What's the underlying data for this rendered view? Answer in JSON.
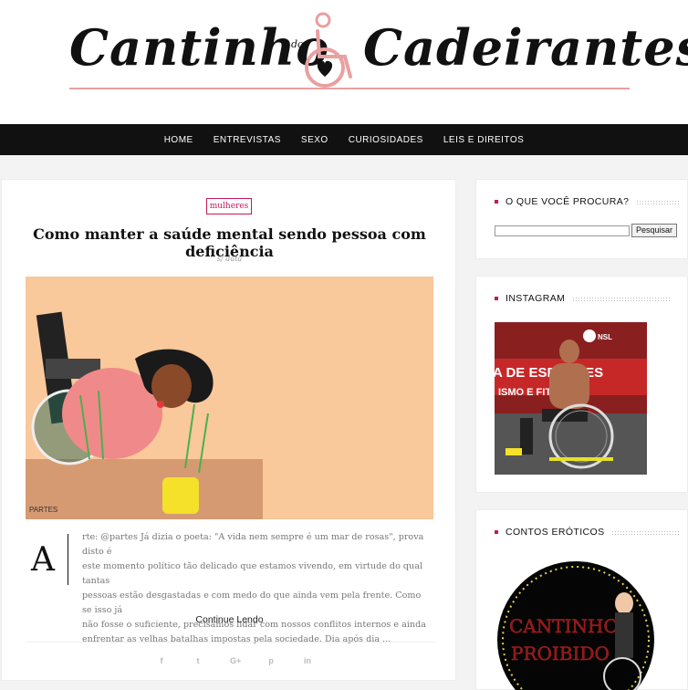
{
  "logo": {
    "left_text": "Cantinho",
    "small_text": "dos",
    "right_text": "Cadeirantes"
  },
  "nav": {
    "items": [
      "HOME",
      "ENTREVISTAS",
      "SEXO",
      "CURIOSIDADES",
      "LEIS E DIREITOS"
    ]
  },
  "post": {
    "category": "mulheres",
    "title": "Como manter a saúde mental sendo pessoa com deficiência",
    "date": "s/ data",
    "image_caption": "PARTES",
    "dropcap": "A",
    "excerpt_lines": [
      "rte: @partes  Já dizia o poeta: \"A vida nem sempre é um mar de rosas\", prova disto é",
      "este momento político tão delicado que estamos vivendo, em virtude do qual tantas",
      "pessoas estão desgastadas e com medo do que ainda vem pela frente. Como se isso já",
      "não fosse o suficiente, precisamos lidar com nossos conflitos internos e ainda",
      "enfrentar as velhas batalhas impostas pela sociedade. Dia após dia ..."
    ],
    "continue_label": "Continue Lendo",
    "share_icons": [
      "facebook-icon",
      "twitter-icon",
      "google-plus-icon",
      "pinterest-icon",
      "linkedin-icon"
    ],
    "share_glyphs": [
      "f",
      "t",
      "G+",
      "p",
      "in"
    ]
  },
  "sidebar": {
    "search": {
      "title": "O QUE VOCÊ PROCURA?",
      "button": "Pesquisar",
      "placeholder": ""
    },
    "instagram": {
      "title": "INSTAGRAM",
      "banner_text": "A DE ESPORTES",
      "banner_text2": "ISMO E FITNESS",
      "logo_text": "NSL"
    },
    "contos": {
      "title": "CONTOS ERÓTICOS",
      "image_line1": "CANTINHO",
      "image_line2": "PROIBIDO"
    }
  },
  "colors": {
    "accent": "#c2185b",
    "nav_bg": "#111111",
    "logo_pink": "#e8a0a0",
    "image_bg": "#f9c89b"
  }
}
